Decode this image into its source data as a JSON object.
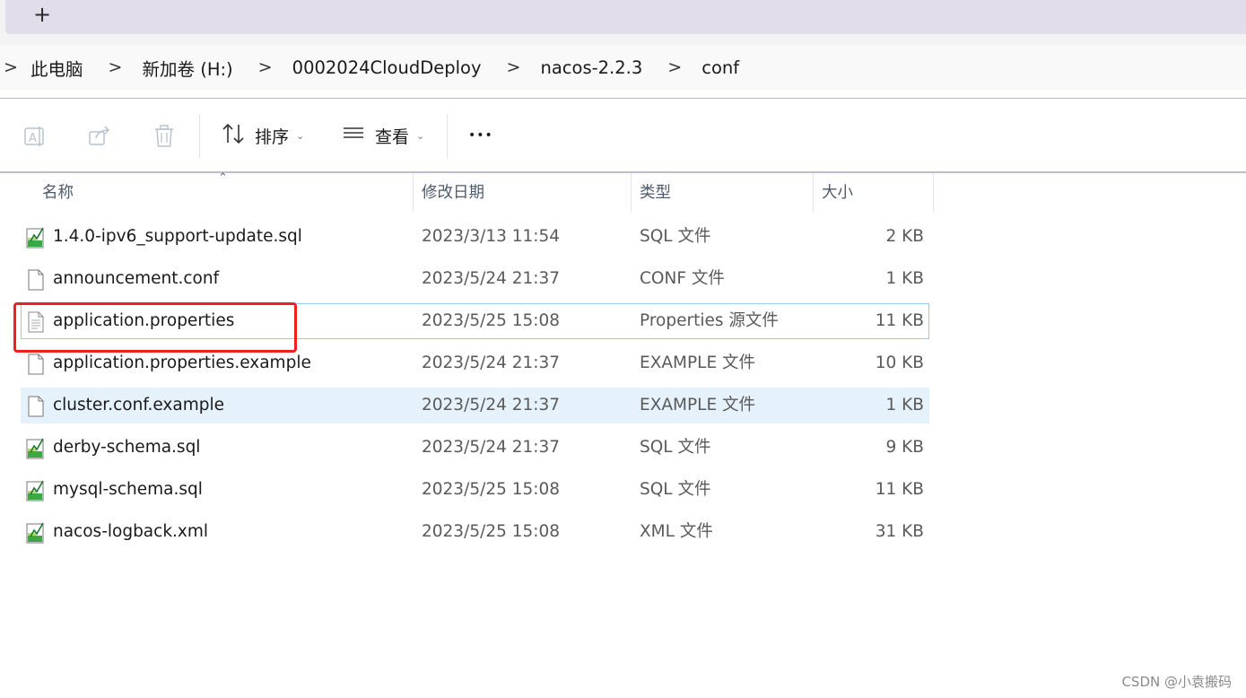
{
  "tabs": {
    "new_tab_label": "+"
  },
  "breadcrumb": {
    "items": [
      "此电脑",
      "新加卷 (H:)",
      "0002024CloudDeploy",
      "nacos-2.2.3",
      "conf"
    ],
    "separator": ">"
  },
  "toolbar": {
    "sort_label": "排序",
    "view_label": "查看",
    "more_label": "•••",
    "icons": [
      "rename-icon",
      "share-icon",
      "delete-icon",
      "sort-icon",
      "view-icon",
      "more-icon"
    ]
  },
  "columns": {
    "name": "名称",
    "date": "修改日期",
    "type": "类型",
    "size": "大小"
  },
  "files": [
    {
      "name": "1.4.0-ipv6_support-update.sql",
      "date": "2023/3/13 11:54",
      "type": "SQL 文件",
      "size": "2 KB",
      "icon": "sql-file-icon"
    },
    {
      "name": "announcement.conf",
      "date": "2023/5/24 21:37",
      "type": "CONF 文件",
      "size": "1 KB",
      "icon": "blank-file-icon"
    },
    {
      "name": "application.properties",
      "date": "2023/5/25 15:08",
      "type": "Properties 源文件",
      "size": "11 KB",
      "icon": "text-file-icon"
    },
    {
      "name": "application.properties.example",
      "date": "2023/5/24 21:37",
      "type": "EXAMPLE 文件",
      "size": "10 KB",
      "icon": "blank-file-icon"
    },
    {
      "name": "cluster.conf.example",
      "date": "2023/5/24 21:37",
      "type": "EXAMPLE 文件",
      "size": "1 KB",
      "icon": "blank-file-icon"
    },
    {
      "name": "derby-schema.sql",
      "date": "2023/5/24 21:37",
      "type": "SQL 文件",
      "size": "9 KB",
      "icon": "sql-file-icon"
    },
    {
      "name": "mysql-schema.sql",
      "date": "2023/5/25 15:08",
      "type": "SQL 文件",
      "size": "11 KB",
      "icon": "sql-file-icon"
    },
    {
      "name": "nacos-logback.xml",
      "date": "2023/5/25 15:08",
      "type": "XML 文件",
      "size": "31 KB",
      "icon": "sql-file-icon"
    }
  ],
  "selection": {
    "focused_file": "application.properties",
    "selected_file": "cluster.conf.example",
    "annotated_file": "application.properties"
  },
  "colors": {
    "annotation": "#f02020",
    "selected_row": "#e5f1fb",
    "tab_bar": "#e1ddea"
  },
  "watermark": "CSDN @小袁搬码"
}
